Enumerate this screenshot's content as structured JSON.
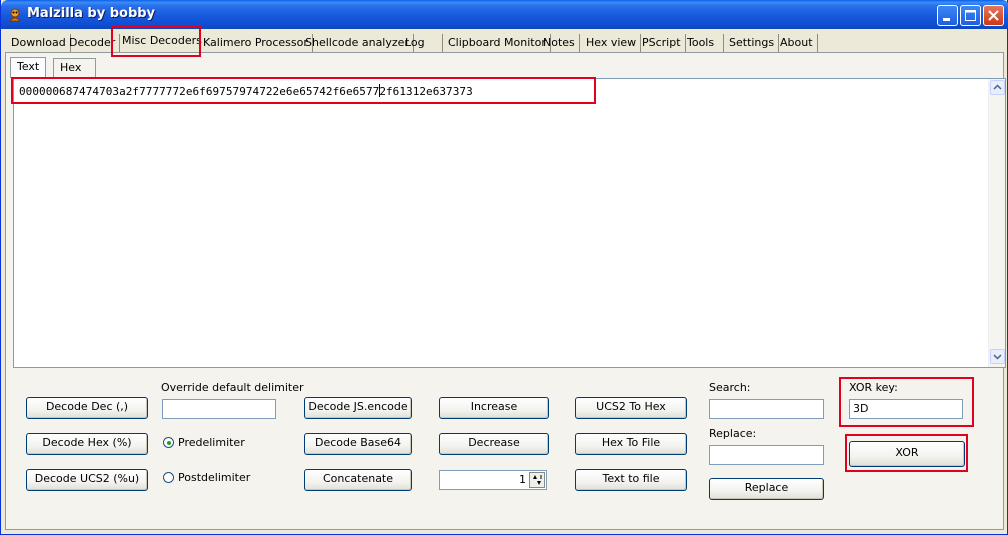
{
  "window": {
    "title": "Malzilla by bobby"
  },
  "tabs": [
    {
      "label": "Download"
    },
    {
      "label": "Decoder"
    },
    {
      "label": "Misc Decoders"
    },
    {
      "label": "Kalimero Processor"
    },
    {
      "label": "Shellcode analyzer"
    },
    {
      "label": "Log"
    },
    {
      "label": "Clipboard Monitor"
    },
    {
      "label": "Notes"
    },
    {
      "label": "Hex view"
    },
    {
      "label": "PScript"
    },
    {
      "label": "Tools"
    },
    {
      "label": "Settings"
    },
    {
      "label": "About"
    }
  ],
  "active_tab": "Misc Decoders",
  "subtabs": [
    {
      "label": "Text"
    },
    {
      "label": "Hex"
    }
  ],
  "editor": {
    "text_before_caret": "000000687474703a2f7777772e6f69757974722e6e65742f6e6577",
    "text_after_caret": "2f61312e637373"
  },
  "buttons": {
    "decode_dec": "Decode Dec (,)",
    "decode_hex": "Decode Hex (%)",
    "decode_ucs2": "Decode UCS2 (%u)",
    "decode_js": "Decode JS.encode",
    "decode_base64": "Decode Base64",
    "concatenate": "Concatenate",
    "increase": "Increase",
    "decrease": "Decrease",
    "ucs2_to_hex": "UCS2 To Hex",
    "hex_to_file": "Hex To File",
    "text_to_file": "Text to file",
    "replace": "Replace",
    "xor": "XOR"
  },
  "delimiter": {
    "label": "Override default delimiter",
    "value": "",
    "options": [
      "Predelimiter",
      "Postdelimiter"
    ],
    "selected": "Predelimiter"
  },
  "stepper": {
    "value": "1"
  },
  "search": {
    "label": "Search:",
    "value": ""
  },
  "replace_field": {
    "label": "Replace:",
    "value": ""
  },
  "xor": {
    "label": "XOR key:",
    "value": "3D"
  },
  "colors": {
    "highlight": "#E1001E",
    "title_bar": "#0F4ED3",
    "face": "#ECE9D8"
  }
}
